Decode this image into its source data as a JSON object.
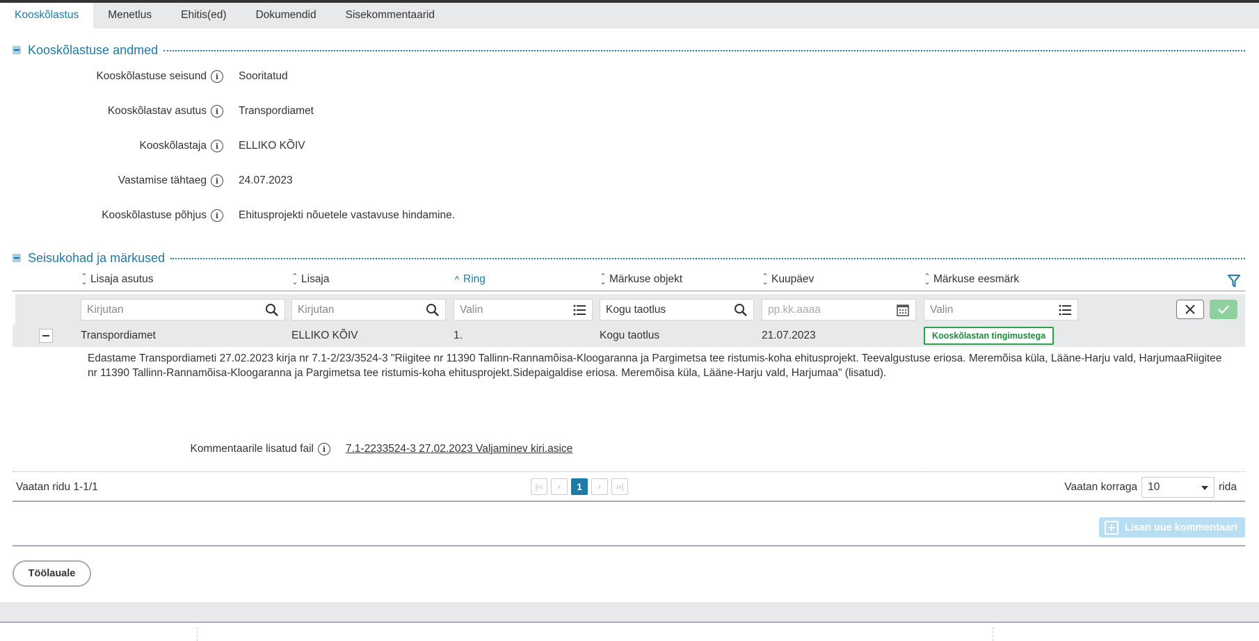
{
  "tabs": [
    {
      "label": "Kooskõlastus",
      "active": true
    },
    {
      "label": "Menetlus",
      "active": false
    },
    {
      "label": "Ehitis(ed)",
      "active": false
    },
    {
      "label": "Dokumendid",
      "active": false
    },
    {
      "label": "Sisekommentaarid",
      "active": false
    }
  ],
  "section1": {
    "title": "Kooskõlastuse andmed",
    "fields": [
      {
        "label": "Kooskõlastuse seisund",
        "value": "Sooritatud"
      },
      {
        "label": "Kooskõlastav asutus",
        "value": "Transpordiamet"
      },
      {
        "label": "Kooskõlastaja",
        "value": "ELLIKO KÕIV"
      },
      {
        "label": "Vastamise tähtaeg",
        "value": "24.07.2023"
      },
      {
        "label": "Kooskõlastuse põhjus",
        "value": "Ehitusprojekti nõuetele vastavuse hindamine."
      }
    ]
  },
  "section2": {
    "title": "Seisukohad ja märkused",
    "columns": [
      "Lisaja asutus",
      "Lisaja",
      "Ring",
      "Märkuse objekt",
      "Kuupäev",
      "Märkuse eesmärk"
    ],
    "filters": {
      "f1": "Kirjutan",
      "f2": "Kirjutan",
      "f3": "Valin",
      "f4": "Kogu taotlus",
      "f5": "pp.kk.aaaa",
      "f6": "Valin"
    },
    "row": {
      "asutus": "Transpordiamet",
      "lisaja": "ELLIKO KÕIV",
      "ring": "1.",
      "objekt": "Kogu taotlus",
      "kuupaev": "21.07.2023",
      "eesmark": "Kooskõlastan tingimustega"
    },
    "comment": "Edastame Transpordiameti  27.02.2023 kirja nr 7.1-2/23/3524-3 \"Riigitee nr 11390 Tallinn-Rannamõisa-Kloogaranna ja Pargimetsa tee ristumis-koha ehitusprojekt. Teevalgustuse eriosa. Meremõisa küla, Lääne-Harju vald, HarjumaaRiigitee nr 11390 Tallinn-Rannamõisa-Kloogaranna ja Pargimetsa tee ristumis-koha ehitusprojekt.Sidepaigaldise eriosa. Meremõisa küla, Lääne-Harju vald, Harjumaa\" (lisatud).",
    "attachment_label": "Kommentaarile lisatud fail",
    "attachment_link": "7.1-2233524-3 27.02.2023 Valjaminev kiri.asice"
  },
  "pager": {
    "info": "Vaatan ridu 1-1/1",
    "current_page": "1",
    "per_page_label": "Vaatan korraga",
    "per_page_value": "10",
    "per_page_suffix": "rida"
  },
  "add_comment_label": "Lisan uue kommentaari",
  "back_label": "Töölauale",
  "colors": {
    "accent": "#1d7ba8",
    "badge_green": "#27a146",
    "ok_green": "#8ed19e"
  }
}
